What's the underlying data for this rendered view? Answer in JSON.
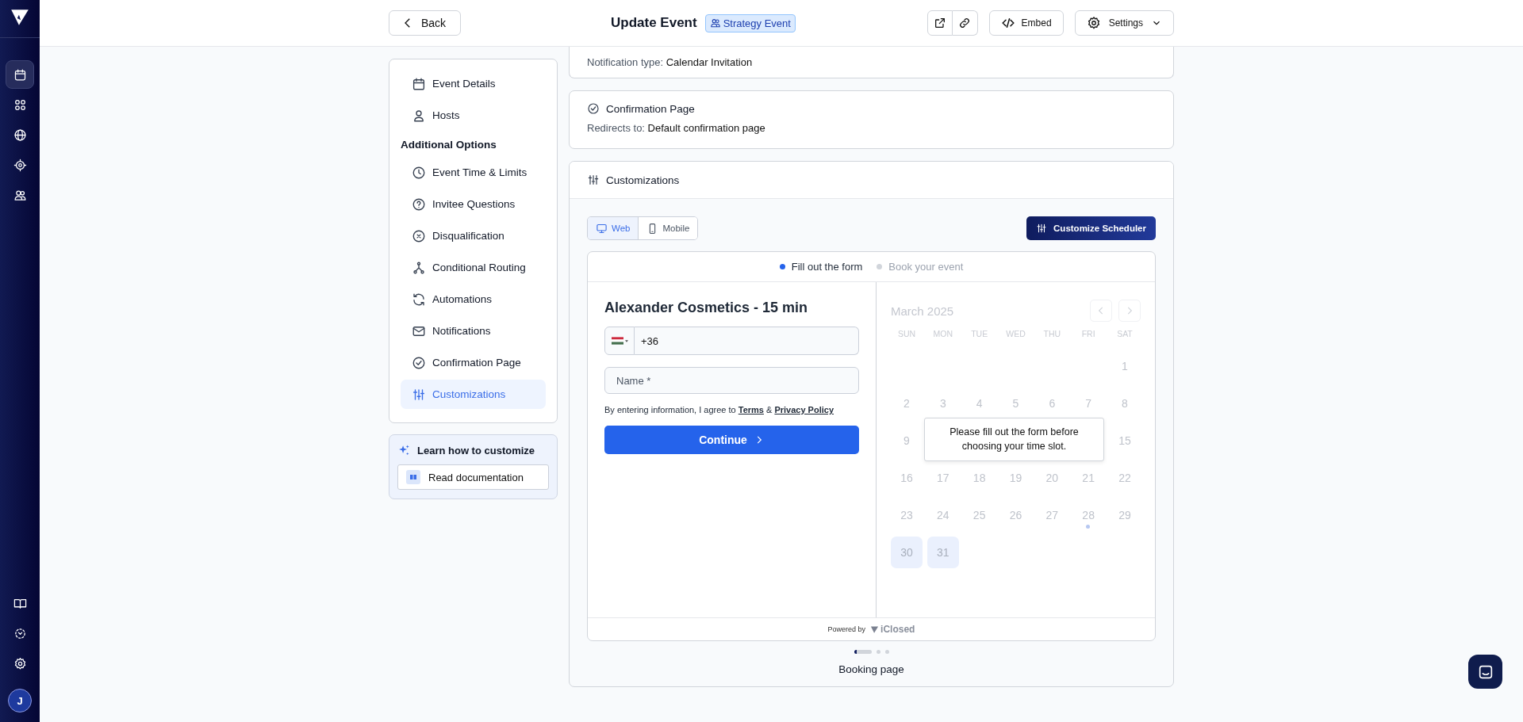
{
  "rail": {
    "top": [
      {
        "kind": "calendar",
        "selected": true
      },
      {
        "kind": "grid",
        "selected": false
      },
      {
        "kind": "globe",
        "selected": false
      },
      {
        "kind": "target",
        "selected": false
      },
      {
        "kind": "users",
        "selected": false
      }
    ],
    "bottom": [
      {
        "kind": "book",
        "selected": false
      },
      {
        "kind": "scan",
        "selected": false
      },
      {
        "kind": "gear",
        "selected": false
      }
    ],
    "avatar": "J"
  },
  "header": {
    "back": "Back",
    "title": "Update Event",
    "tag": "Strategy Event",
    "embed": "Embed",
    "settings": "Settings"
  },
  "menu": {
    "items": [
      {
        "label": "Event Details",
        "kind": "calendar",
        "selected": false
      },
      {
        "label": "Hosts",
        "kind": "user",
        "selected": false
      }
    ],
    "section_title": "Additional Options",
    "section_items": [
      {
        "label": "Event Time & Limits",
        "kind": "clock",
        "selected": false
      },
      {
        "label": "Invitee Questions",
        "kind": "question",
        "selected": false
      },
      {
        "label": "Disqualification",
        "kind": "xcircle",
        "selected": false
      },
      {
        "label": "Conditional Routing",
        "kind": "routing",
        "selected": false
      },
      {
        "label": "Automations",
        "kind": "refresh",
        "selected": false
      },
      {
        "label": "Notifications",
        "kind": "mail",
        "selected": false
      },
      {
        "label": "Confirmation Page",
        "kind": "check",
        "selected": false
      },
      {
        "label": "Customizations",
        "kind": "sliders",
        "selected": true
      }
    ]
  },
  "learn": {
    "title": "Learn how to customize",
    "button": "Read documentation"
  },
  "notification_card": {
    "label": "Notification type:",
    "value": "Calendar Invitation"
  },
  "confirmation_card": {
    "title": "Confirmation Page",
    "label": "Redirects to:",
    "value": "Default confirmation page"
  },
  "customizations": {
    "title": "Customizations",
    "devices": [
      {
        "label": "Web",
        "kind": "monitor",
        "selected": true
      },
      {
        "label": "Mobile",
        "kind": "phone",
        "selected": false
      }
    ],
    "customize_button": "Customize Scheduler",
    "preview": {
      "steps": [
        {
          "label": "Fill out the form",
          "selected": true
        },
        {
          "label": "Book your event",
          "selected": false
        }
      ],
      "event_title": "Alexander Cosmetics - 15 min",
      "phone_value": "+36",
      "name_placeholder": "Name *",
      "consent": {
        "text": "By entering information, I agree to",
        "terms": "Terms",
        "separator": "&",
        "privacy": "Privacy Policy"
      },
      "continue": "Continue",
      "calendar": {
        "month": "March 2025",
        "weekdays": [
          "SUN",
          "MON",
          "TUE",
          "WED",
          "THU",
          "FRI",
          "SAT"
        ],
        "weeks": [
          [
            {
              "label": "1",
              "available": false,
              "marker": false
            }
          ],
          [
            {
              "label": "2",
              "available": false,
              "marker": false
            },
            {
              "label": "3",
              "available": false,
              "marker": false
            },
            {
              "label": "4",
              "available": false,
              "marker": false
            },
            {
              "label": "5",
              "available": false,
              "marker": false
            },
            {
              "label": "6",
              "available": false,
              "marker": false
            },
            {
              "label": "7",
              "available": false,
              "marker": false
            },
            {
              "label": "8",
              "available": false,
              "marker": false
            }
          ],
          [
            {
              "label": "9",
              "available": false,
              "marker": false
            },
            {
              "label": "15",
              "available": false,
              "marker": false
            }
          ],
          [
            {
              "label": "16",
              "available": false,
              "marker": false
            },
            {
              "label": "17",
              "available": false,
              "marker": false
            },
            {
              "label": "18",
              "available": false,
              "marker": false
            },
            {
              "label": "19",
              "available": false,
              "marker": false
            },
            {
              "label": "20",
              "available": false,
              "marker": false
            },
            {
              "label": "21",
              "available": false,
              "marker": false
            },
            {
              "label": "22",
              "available": false,
              "marker": false
            }
          ],
          [
            {
              "label": "23",
              "available": false,
              "marker": false
            },
            {
              "label": "24",
              "available": false,
              "marker": false
            },
            {
              "label": "25",
              "available": false,
              "marker": false
            },
            {
              "label": "26",
              "available": false,
              "marker": false
            },
            {
              "label": "27",
              "available": false,
              "marker": false
            },
            {
              "label": "28",
              "available": false,
              "marker": true
            },
            {
              "label": "29",
              "available": false,
              "marker": false
            }
          ],
          [
            {
              "label": "30",
              "available": true,
              "marker": false
            },
            {
              "label": "31",
              "available": true,
              "marker": false
            }
          ]
        ],
        "tooltip": "Please fill out the form before choosing your time slot."
      },
      "footer": {
        "powered_by": "Powered by",
        "brand": "iClosed"
      }
    },
    "slides": [
      {
        "selected": true
      },
      {
        "selected": false
      },
      {
        "selected": false
      }
    ],
    "caption": "Booking page"
  }
}
